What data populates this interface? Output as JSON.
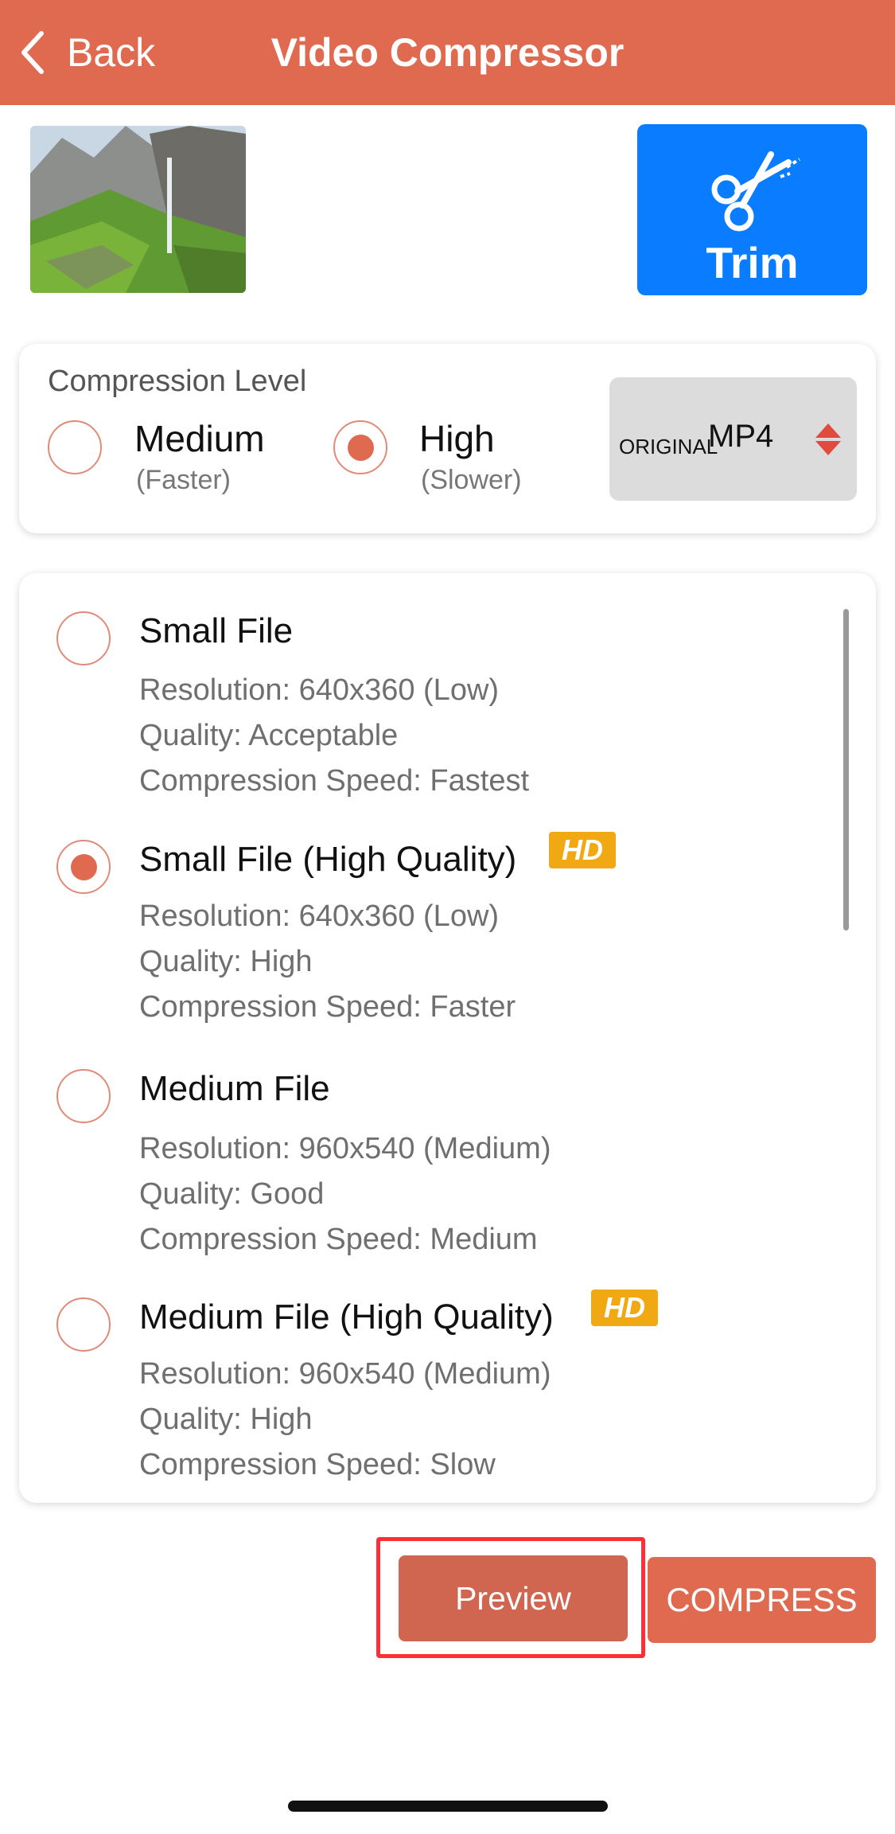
{
  "header": {
    "back_label": "Back",
    "title": "Video Compressor",
    "background": "#e06a50"
  },
  "trim": {
    "label": "Trim",
    "icon": "scissors-icon",
    "background": "#0a7cff"
  },
  "compression_level": {
    "heading": "Compression Level",
    "options": [
      {
        "label": "Medium",
        "sub": "(Faster)",
        "selected": false
      },
      {
        "label": "High",
        "sub": "(Slower)",
        "selected": true
      }
    ],
    "format": {
      "prefix": "ORIGINAL",
      "value": "MP4"
    }
  },
  "presets": [
    {
      "title": "Small File",
      "hd": false,
      "selected": false,
      "lines": [
        "Resolution: 640x360 (Low)",
        "Quality: Acceptable",
        "Compression Speed: Fastest"
      ]
    },
    {
      "title": "Small File (High Quality)",
      "hd": true,
      "selected": true,
      "lines": [
        "Resolution: 640x360 (Low)",
        "Quality: High",
        "Compression Speed: Faster"
      ]
    },
    {
      "title": "Medium File",
      "hd": false,
      "selected": false,
      "lines": [
        "Resolution: 960x540 (Medium)",
        "Quality: Good",
        "Compression Speed: Medium"
      ]
    },
    {
      "title": "Medium File (High Quality)",
      "hd": true,
      "selected": false,
      "lines": [
        "Resolution: 960x540 (Medium)",
        "Quality: High",
        "Compression Speed: Slow"
      ]
    }
  ],
  "hd_badge": "HD",
  "buttons": {
    "preview": "Preview",
    "compress": "COMPRESS"
  },
  "colors": {
    "accent": "#e06a50",
    "highlight": "#ff2f3a",
    "hd": "#f0a813"
  }
}
